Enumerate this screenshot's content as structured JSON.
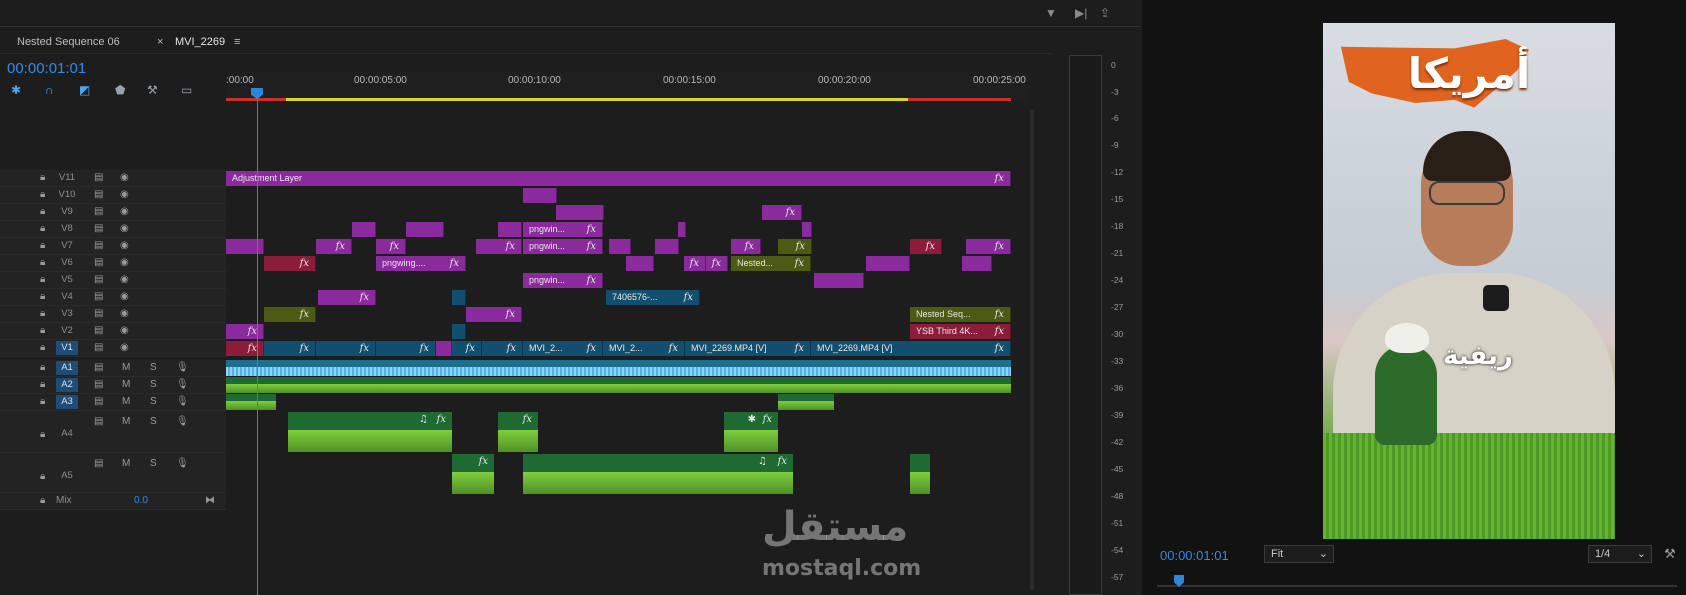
{
  "timeline": {
    "tabs": [
      {
        "label": "Nested Sequence 06"
      },
      {
        "label": "MVI_2269"
      }
    ],
    "tab_close": "×",
    "tab_menu": "≡",
    "timecode": "00:00:01:01",
    "ruler_labels": [
      ":00:00",
      "00:00:05:00",
      "00:00:10:00",
      "00:00:15:00",
      "00:00:20:00",
      "00:00:25:00"
    ],
    "video_tracks": [
      "V11",
      "V10",
      "V9",
      "V8",
      "V7",
      "V6",
      "V5",
      "V4",
      "V3",
      "V2",
      "V1"
    ],
    "audio_tracks": [
      "A1",
      "A2",
      "A3",
      "A4",
      "A5"
    ],
    "mix_label": "Mix",
    "mix_value": "0.0",
    "audio_buttons": {
      "m": "M",
      "s": "S"
    },
    "fx": "fx",
    "clips": {
      "adjustment_layer": "Adjustment Layer",
      "png1": "pngwin...",
      "png2": "pngwin...",
      "png3": "pngwing....",
      "png4": "pngwin...",
      "nested1": "Nested...",
      "clip7406": "7406576-...",
      "nested_seq": "Nested Seq...",
      "ysb": "YSB Third 4K...",
      "v1a": "MVI_2...",
      "v1b": "MVI_2...",
      "v1c": "MVI_2269.MP4 [V]",
      "v1d": "MVI_2269.MP4 [V]"
    }
  },
  "meter": {
    "db_labels": [
      "0",
      "-3",
      "-6",
      "-9",
      "-12",
      "-15",
      "-18",
      "-21",
      "-24",
      "-27",
      "-30",
      "-33",
      "-36",
      "-39",
      "-42",
      "-45",
      "-48",
      "-51",
      "-54",
      "-57"
    ]
  },
  "program": {
    "timecode": "00:00:01:01",
    "fit": "Fit",
    "resolution": "1/4",
    "overlay_title": "أمريكا",
    "overlay_label": "ريفية"
  },
  "watermark": {
    "arabic": "مستقل",
    "latin": "mostaql.com"
  },
  "colors": {
    "accent": "#2d8ceb",
    "clip_purple": "#8a2a9d",
    "clip_red": "#8b1d3a",
    "clip_teal": "#124f6e",
    "clip_olive": "#4c5a13",
    "audio_green": "#1f6a33"
  }
}
